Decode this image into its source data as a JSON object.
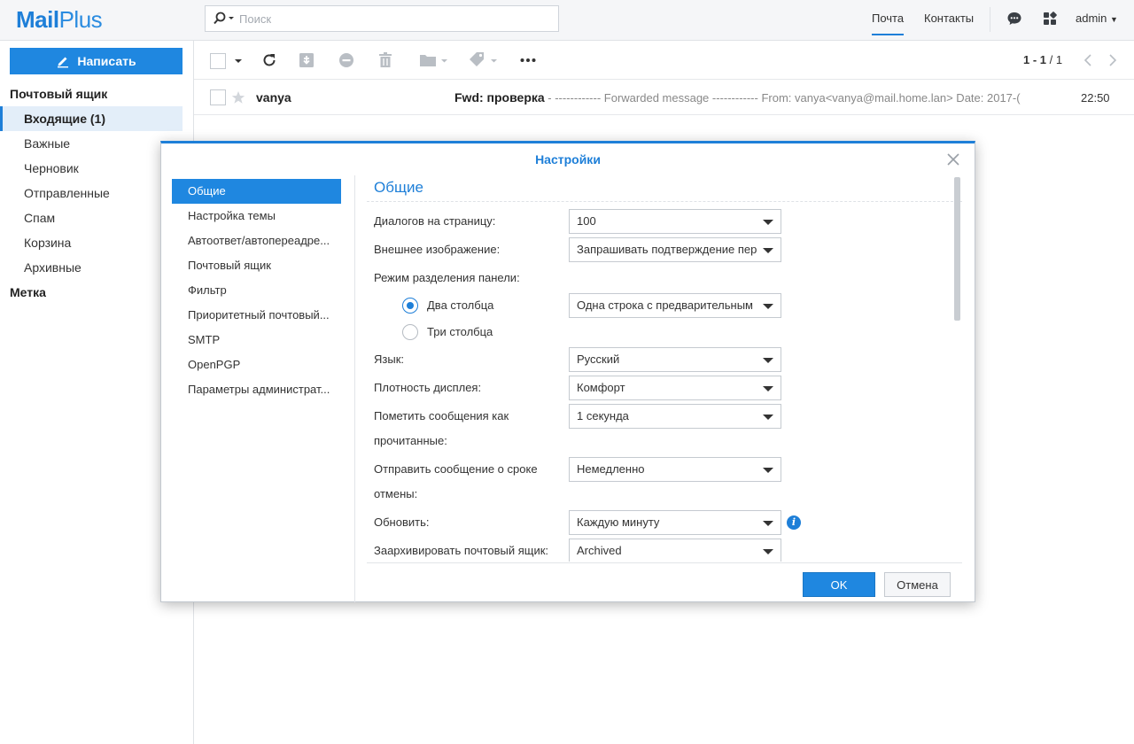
{
  "app": {
    "logo_main": "Mail",
    "logo_plus": "Plus"
  },
  "search": {
    "placeholder": "Поиск"
  },
  "nav": {
    "mail_tab": "Почта",
    "contacts_tab": "Контакты",
    "user": "admin"
  },
  "sidebar": {
    "compose_label": "Написать",
    "mailbox_heading": "Почтовый ящик",
    "items": [
      {
        "label": "Входящие (1)"
      },
      {
        "label": "Важные"
      },
      {
        "label": "Черновик"
      },
      {
        "label": "Отправленные"
      },
      {
        "label": "Спам"
      },
      {
        "label": "Корзина"
      },
      {
        "label": "Архивные"
      }
    ],
    "label_heading": "Метка"
  },
  "toolbar": {
    "pager_range": "1 - 1",
    "pager_sep": " / ",
    "pager_total": "1"
  },
  "messages": [
    {
      "sender": "vanya",
      "subject": "Fwd: проверка",
      "preview": " - ------------ Forwarded message ------------ From: vanya<vanya@mail.home.lan> Date: 2017-(",
      "time": "22:50"
    }
  ],
  "dialog": {
    "title": "Настройки",
    "nav": [
      {
        "label": "Общие"
      },
      {
        "label": "Настройка темы"
      },
      {
        "label": "Автоответ/автопереадре..."
      },
      {
        "label": "Почтовый ящик"
      },
      {
        "label": "Фильтр"
      },
      {
        "label": "Приоритетный почтовый..."
      },
      {
        "label": "SMTP"
      },
      {
        "label": "OpenPGP"
      },
      {
        "label": "Параметры администрат..."
      }
    ],
    "section_title": "Общие",
    "fields": {
      "per_page": {
        "label": "Диалогов на страницу:",
        "value": "100"
      },
      "external_image": {
        "label": "Внешнее изображение:",
        "value": "Запрашивать подтверждение пер"
      },
      "split_mode": {
        "label": "Режим разделения панели:"
      },
      "two_columns": {
        "label": "Два столбца",
        "value": "Одна строка с предварительным"
      },
      "three_columns": {
        "label": "Три столбца"
      },
      "language": {
        "label": "Язык:",
        "value": "Русский"
      },
      "density": {
        "label": "Плотность дисплея:",
        "value": "Комфорт"
      },
      "mark_read": {
        "label_line1": "Пометить сообщения как",
        "label_line2": "прочитанные:",
        "value": "1 секунда"
      },
      "undo_send": {
        "label_line1": "Отправить сообщение о сроке",
        "label_line2": "отмены:",
        "value": "Немедленно"
      },
      "refresh": {
        "label": "Обновить:",
        "value": "Каждую минуту"
      },
      "archive": {
        "label": "Заархивировать почтовый ящик:",
        "value": "Archived"
      }
    },
    "ok_label": "OK",
    "cancel_label": "Отмена"
  },
  "colors": {
    "accent": "#1e7fd8",
    "button": "#1f87e0",
    "selected_bg": "#e3eef9"
  }
}
